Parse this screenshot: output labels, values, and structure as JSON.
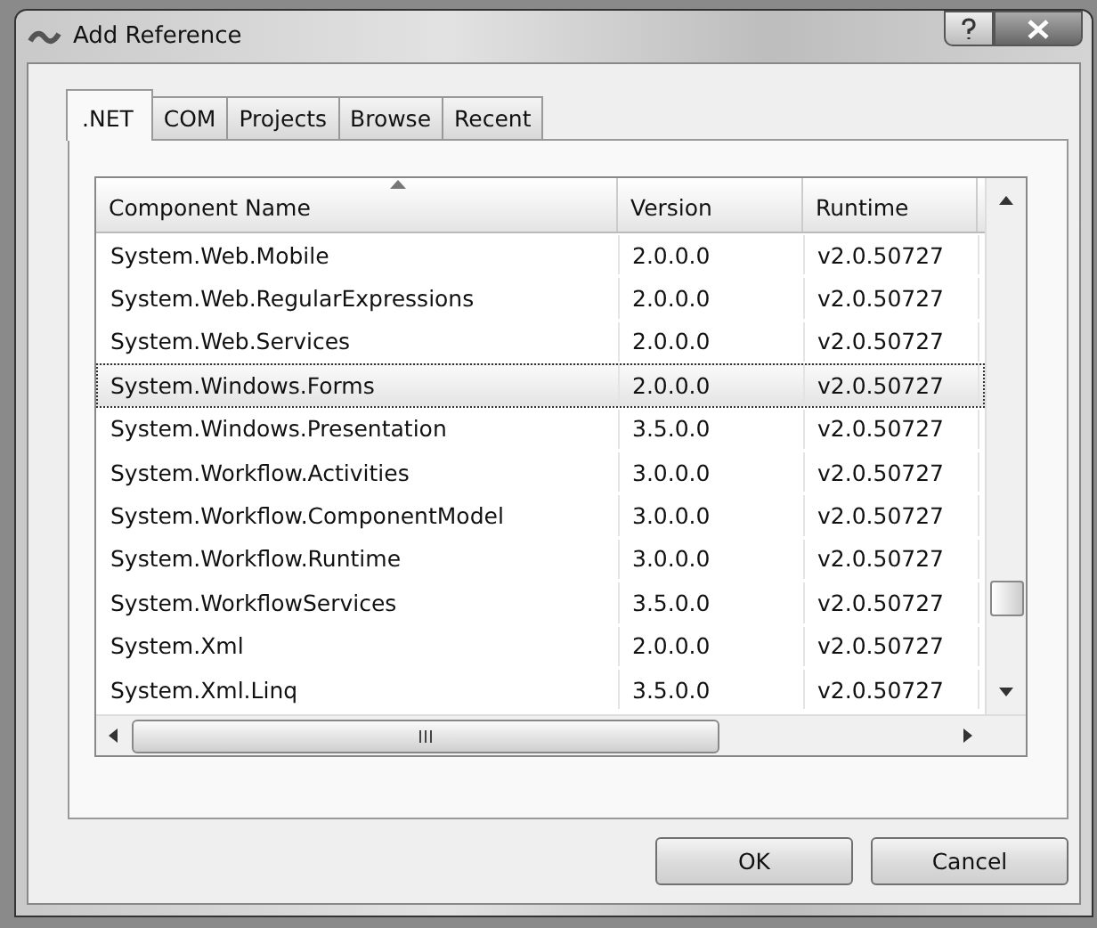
{
  "window": {
    "title": "Add Reference"
  },
  "tabs": [
    {
      "label": ".NET",
      "selected": true
    },
    {
      "label": "COM",
      "selected": false
    },
    {
      "label": "Projects",
      "selected": false
    },
    {
      "label": "Browse",
      "selected": false
    },
    {
      "label": "Recent",
      "selected": false
    }
  ],
  "table": {
    "columns": [
      "Component Name",
      "Version",
      "Runtime"
    ],
    "rows": [
      {
        "cells": [
          "System.Web.Mobile",
          "2.0.0.0",
          "v2.0.50727"
        ],
        "selected": false
      },
      {
        "cells": [
          "System.Web.RegularExpressions",
          "2.0.0.0",
          "v2.0.50727"
        ],
        "selected": false
      },
      {
        "cells": [
          "System.Web.Services",
          "2.0.0.0",
          "v2.0.50727"
        ],
        "selected": false
      },
      {
        "cells": [
          "System.Windows.Forms",
          "2.0.0.0",
          "v2.0.50727"
        ],
        "selected": true
      },
      {
        "cells": [
          "System.Windows.Presentation",
          "3.5.0.0",
          "v2.0.50727"
        ],
        "selected": false
      },
      {
        "cells": [
          "System.Workflow.Activities",
          "3.0.0.0",
          "v2.0.50727"
        ],
        "selected": false
      },
      {
        "cells": [
          "System.Workflow.ComponentModel",
          "3.0.0.0",
          "v2.0.50727"
        ],
        "selected": false
      },
      {
        "cells": [
          "System.Workflow.Runtime",
          "3.0.0.0",
          "v2.0.50727"
        ],
        "selected": false
      },
      {
        "cells": [
          "System.WorkflowServices",
          "3.5.0.0",
          "v2.0.50727"
        ],
        "selected": false
      },
      {
        "cells": [
          "System.Xml",
          "2.0.0.0",
          "v2.0.50727"
        ],
        "selected": false
      },
      {
        "cells": [
          "System.Xml.Linq",
          "3.5.0.0",
          "v2.0.50727"
        ],
        "selected": false
      }
    ]
  },
  "buttons": [
    "OK",
    "Cancel"
  ]
}
